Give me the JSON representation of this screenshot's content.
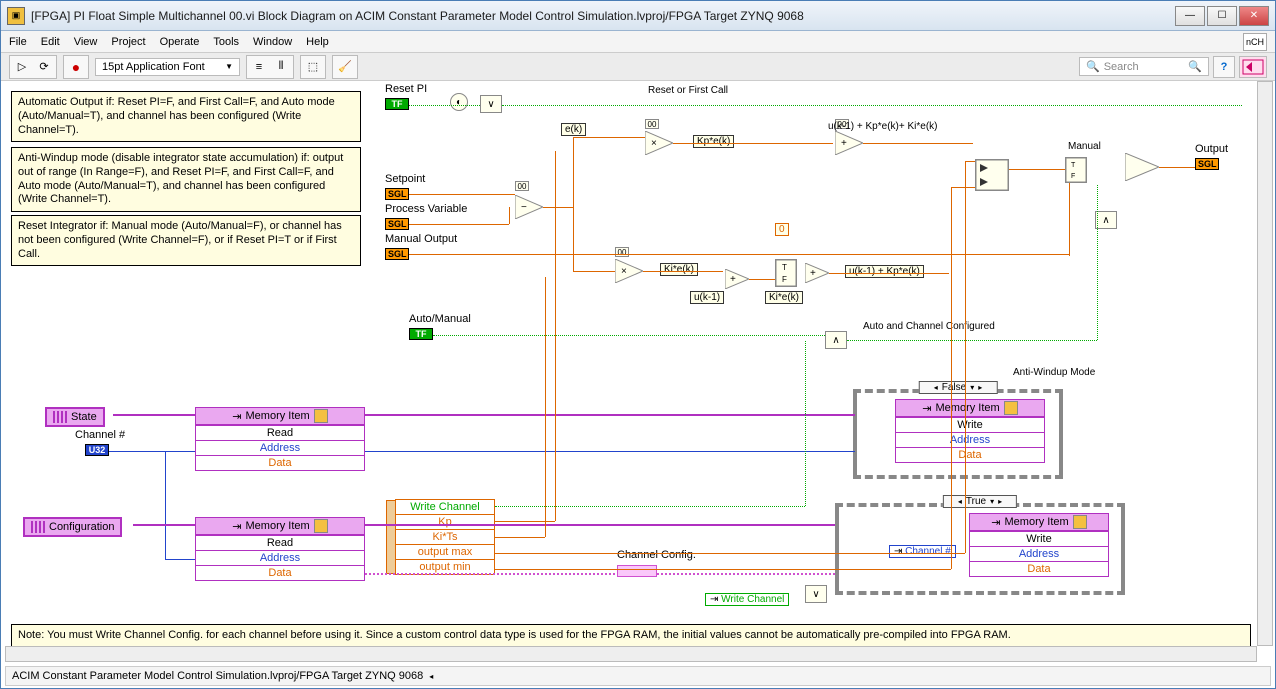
{
  "window": {
    "title": "[FPGA] PI Float Simple Multichannel 00.vi Block Diagram on ACIM Constant Parameter Model Control Simulation.lvproj/FPGA Target ZYNQ 9068"
  },
  "menu": {
    "file": "File",
    "edit": "Edit",
    "view": "View",
    "project": "Project",
    "operate": "Operate",
    "tools": "Tools",
    "window": "Window",
    "help": "Help"
  },
  "toolbar": {
    "font": "15pt Application Font",
    "search_placeholder": "Search"
  },
  "comments": {
    "auto_output": "Automatic Output if:\nReset PI=F, and First Call=F, and Auto mode (Auto/Manual=T), and channel has been configured (Write Channel=T).",
    "anti_windup": "Anti-Windup mode (disable integrator state accumulation) if: output out of range (In Range=F), and Reset PI=F, and First Call=F, and Auto mode (Auto/Manual=T), and channel has been configured (Write Channel=T).",
    "reset_integrator": "Reset Integrator if:\nManual mode (Auto/Manual=F), or channel has not been configured (Write Channel=F), or if Reset PI=T or if First Call.",
    "bottom_note": "Note: You must Write Channel Config. for each channel before using it. Since a custom control data type is used for the FPGA RAM, the initial values cannot be automatically pre-compiled into FPGA RAM."
  },
  "terminals": {
    "reset_pi": "Reset PI",
    "setpoint": "Setpoint",
    "process_variable": "Process Variable",
    "manual_output": "Manual Output",
    "auto_manual": "Auto/Manual",
    "channel_num": "Channel #",
    "state": "State",
    "configuration": "Configuration",
    "output": "Output",
    "manual": "Manual",
    "tf": "TF",
    "sgl": "SGL",
    "u32": "U32"
  },
  "wire_labels": {
    "reset_or_first": "Reset or First Call",
    "ek": "e(k)",
    "kp_ek": "Kp*e(k)",
    "ki_ek": "Ki*e(k)",
    "ki_ek2": "Ki*e(k)",
    "uk1": "u(k-1)",
    "zero": "0",
    "uk1_kp_ki": "u(k-1) + Kp*e(k)+ Ki*e(k)",
    "uk1_kp": "u(k-1) + Kp*e(k)",
    "auto_chan": "Auto and Channel Configured",
    "anti_windup_mode": "Anti-Windup Mode",
    "channel_config": "Channel Config.",
    "write_channel": "Write Channel",
    "channel_num_small": "Channel #"
  },
  "memory": {
    "header": "Memory Item",
    "read": "Read",
    "write": "Write",
    "address": "Address",
    "data": "Data"
  },
  "unbundle": {
    "write_channel": "Write Channel",
    "kp": "Kp",
    "ki_ts": "Ki*Ts",
    "output_max": "output max",
    "output_min": "output min"
  },
  "case": {
    "false": "False",
    "true": "True"
  },
  "statusbar": {
    "path": "ACIM Constant Parameter Model Control Simulation.lvproj/FPGA Target ZYNQ 9068"
  }
}
